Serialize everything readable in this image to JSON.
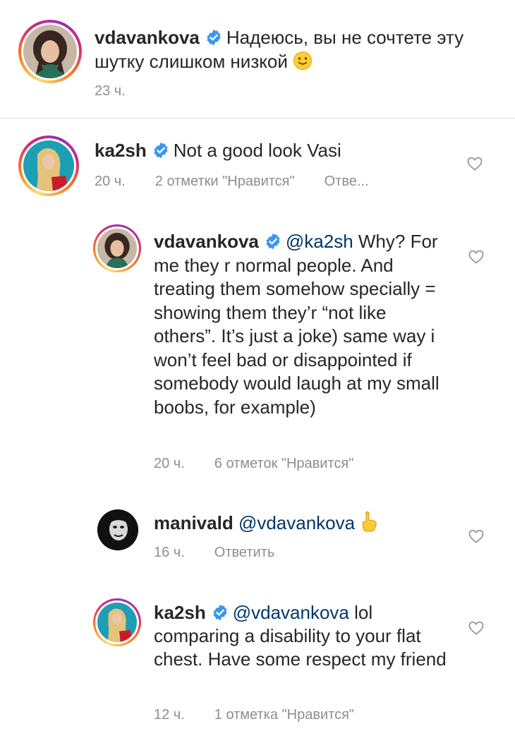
{
  "caption": {
    "username": "vdavankova",
    "verified": true,
    "text": "Надеюсь, вы не сочтете эту шутку слишком низкой",
    "emoji": "slightly-smiling-face",
    "time": "23 ч."
  },
  "comments": [
    {
      "username": "ka2sh",
      "verified": true,
      "mention": "",
      "text": "Not a good look Vasi",
      "time": "20 ч.",
      "likes": "2 отметки \"Нравится\"",
      "reply": "Отве..."
    },
    {
      "username": "vdavankova",
      "verified": true,
      "mention": "@ka2sh",
      "text": "Why? For me they r normal people. And treating them somehow specially = showing them they’r “not like others”. It’s just a joke) same way i won’t feel bad or disappointed if somebody would laugh at my small boobs, for example)",
      "time": "20 ч.",
      "likes": "6 отметок \"Нравится\"",
      "reply": ""
    },
    {
      "username": "manivald",
      "verified": false,
      "mention": "@vdavankova",
      "text": "",
      "emoji": "pointing-up-hand",
      "time": "16 ч.",
      "likes": "",
      "reply": "Ответить"
    },
    {
      "username": "ka2sh",
      "verified": true,
      "mention": "@vdavankova",
      "text": "lol comparing a disability to your flat chest. Have some respect my friend",
      "time": "12 ч.",
      "likes": "1 отметка \"Нравится\"",
      "reply": ""
    }
  ],
  "colors": {
    "text": "#262626",
    "meta": "#8e8e8e",
    "mention": "#00376b",
    "verified": "#3897f0",
    "divider": "#dbdbdb"
  }
}
